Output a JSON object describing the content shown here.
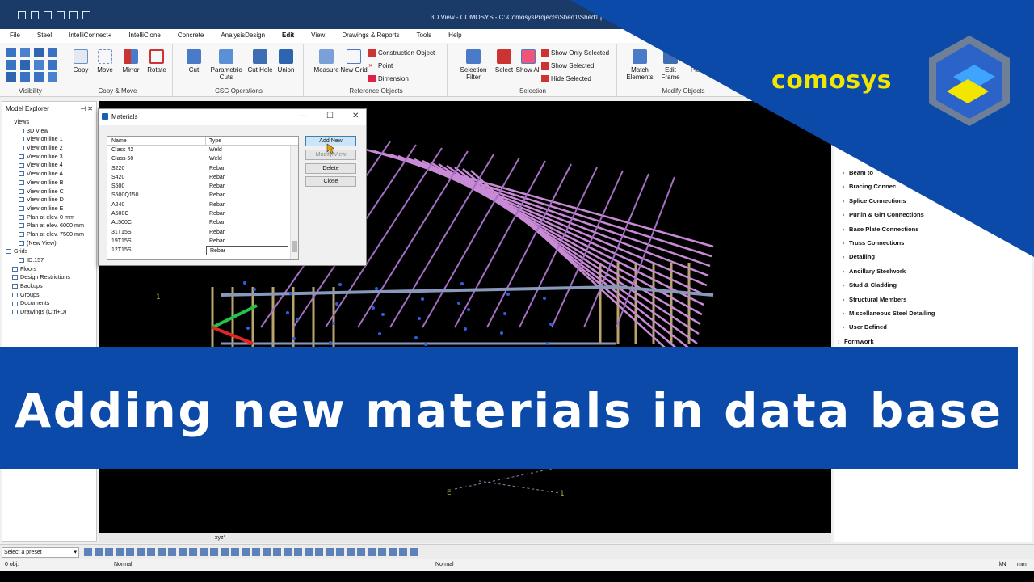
{
  "window": {
    "title": "3D View - COMOSYS - C:\\ComosysProjects\\Shed1\\Shed1.px..."
  },
  "menu": [
    "File",
    "Steel",
    "IntelliConnect+",
    "IntelliClone",
    "Concrete",
    "AnalysisDesign",
    "Edit",
    "View",
    "Drawings & Reports",
    "Tools",
    "Help"
  ],
  "menu_active": "Edit",
  "ribbon": {
    "groups": {
      "visibility": "Visibility",
      "copy_move": "Copy & Move",
      "csg": "CSG Operations",
      "reference": "Reference Objects",
      "selection": "Selection",
      "modify": "Modify Objects"
    },
    "buttons": {
      "copy": "Copy",
      "move": "Move",
      "mirror": "Mirror",
      "rotate": "Rotate",
      "cut": "Cut",
      "parametric_cuts": "Parametric Cuts",
      "cut_hole": "Cut Hole",
      "union": "Union",
      "measure": "Measure",
      "new_grid": "New Grid",
      "construction_object": "Construction Object",
      "point": "Point",
      "dimension": "Dimension",
      "selection_filter": "Selection Filter",
      "select": "Select",
      "show_all": "Show All",
      "show_only_selected": "Show Only Selected",
      "show_selected": "Show Selected",
      "hide_selected": "Hide Selected",
      "match_elements": "Match Elements",
      "edit_frame": "Edit Frame",
      "plate": "Plate"
    }
  },
  "explorer": {
    "title": "Model Explorer",
    "items": [
      {
        "label": "Views",
        "indent": 0
      },
      {
        "label": "3D View",
        "indent": 2
      },
      {
        "label": "View on line 1",
        "indent": 2
      },
      {
        "label": "View on line 2",
        "indent": 2
      },
      {
        "label": "View on line 3",
        "indent": 2
      },
      {
        "label": "View on line 4",
        "indent": 2
      },
      {
        "label": "View on line A",
        "indent": 2
      },
      {
        "label": "View on line B",
        "indent": 2
      },
      {
        "label": "View on line C",
        "indent": 2
      },
      {
        "label": "View on line D",
        "indent": 2
      },
      {
        "label": "View on line E",
        "indent": 2
      },
      {
        "label": "Plan at elev. 0 mm",
        "indent": 2
      },
      {
        "label": "Plan at elev. 6000 mm",
        "indent": 2
      },
      {
        "label": "Plan at elev. 7500 mm",
        "indent": 2
      },
      {
        "label": "(New View)",
        "indent": 2
      },
      {
        "label": "Grids",
        "indent": 0
      },
      {
        "label": "ID:157",
        "indent": 2
      },
      {
        "label": "Floors",
        "indent": 1
      },
      {
        "label": "Design Restrictions",
        "indent": 1
      },
      {
        "label": "Backups",
        "indent": 1
      },
      {
        "label": "Groups",
        "indent": 1
      },
      {
        "label": "Documents",
        "indent": 1
      },
      {
        "label": "Drawings (Ctrl+D)",
        "indent": 1
      }
    ]
  },
  "materials_dialog": {
    "title": "Materials",
    "columns": [
      "Name",
      "Type"
    ],
    "rows": [
      [
        "Class 42",
        "Weld"
      ],
      [
        "Class 50",
        "Weld"
      ],
      [
        "S220",
        "Rebar"
      ],
      [
        "S420",
        "Rebar"
      ],
      [
        "S500",
        "Rebar"
      ],
      [
        "S500Q150",
        "Rebar"
      ],
      [
        "A240",
        "Rebar"
      ],
      [
        "A500C",
        "Rebar"
      ],
      [
        "Ac500C",
        "Rebar"
      ],
      [
        "31T15S",
        "Rebar"
      ],
      [
        "19T15S",
        "Rebar"
      ],
      [
        "12T15S",
        "Rebar"
      ]
    ],
    "buttons": {
      "add_new": "Add New",
      "modify_view": "Modify/View",
      "delete": "Delete",
      "close": "Close"
    }
  },
  "right_panel": {
    "items": [
      "Beam to",
      "Bracing Connec",
      "Splice Connections",
      "Purlin & Girt Connections",
      "Base Plate Connections",
      "Truss Connections",
      "Detailing",
      "Ancillary Steelwork",
      "Stud & Cladding",
      "Structural Members",
      "Miscellaneous Steel Detailing",
      "User Defined",
      "Formwork"
    ]
  },
  "viewport": {
    "grid_labels": [
      "1",
      "E",
      "1"
    ],
    "status_text": "xyz°"
  },
  "toolbar": {
    "preset": "Select a preset"
  },
  "status": {
    "objects": "0 obj.",
    "mode1": "Normal",
    "mode2": "Normal",
    "units": "kN",
    "units2": "mm"
  },
  "banner": {
    "headline": "Adding new materials in data base"
  },
  "brand": {
    "name": "comosys",
    "primary_color": "#0b4aa8",
    "logo_yellow": "#f2e600"
  }
}
